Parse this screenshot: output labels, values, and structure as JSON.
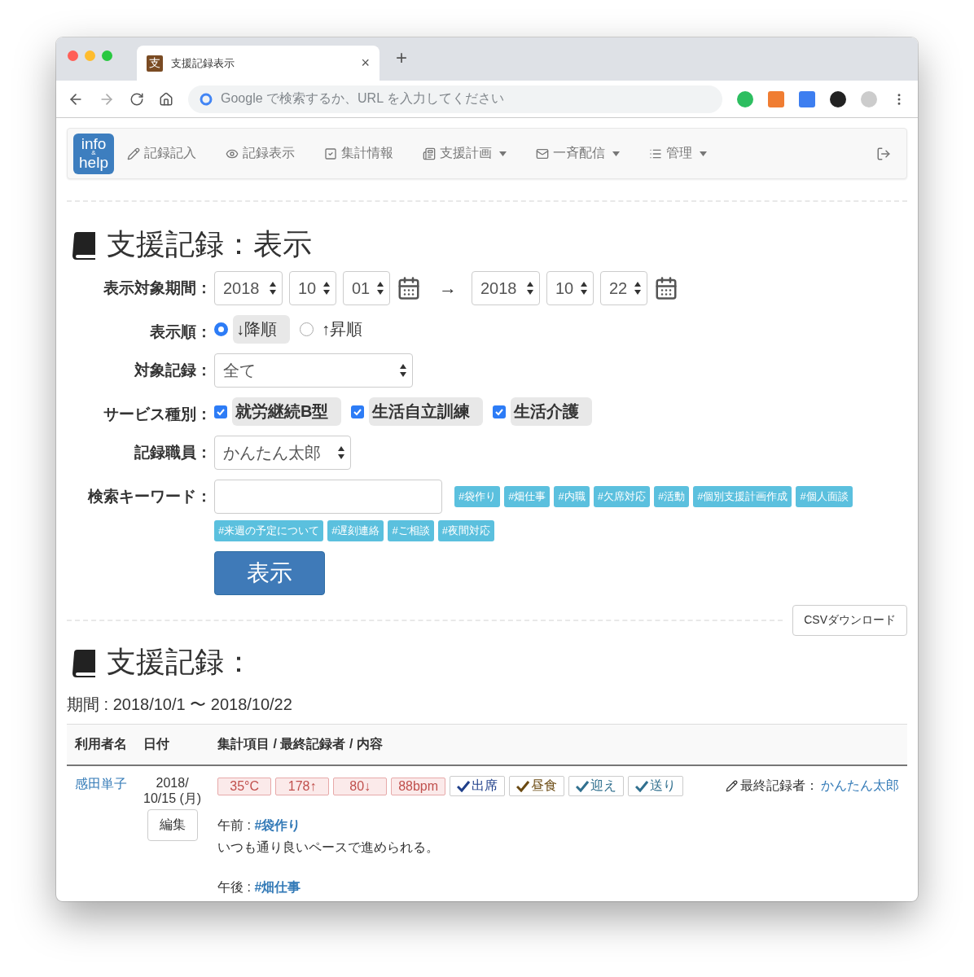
{
  "browser": {
    "tab_title": "支援記録表示",
    "tab_favicon": "支",
    "tab_close": "×",
    "new_tab": "+",
    "address_placeholder": "Google で検索するか、URL を入力してください"
  },
  "navbar": {
    "logo": [
      "info",
      "&",
      "help"
    ],
    "items": [
      {
        "label": "記録記入",
        "dropdown": false
      },
      {
        "label": "記録表示",
        "dropdown": false
      },
      {
        "label": "集計情報",
        "dropdown": false
      },
      {
        "label": "支援計画",
        "dropdown": true
      },
      {
        "label": "一斉配信",
        "dropdown": true
      },
      {
        "label": "管理",
        "dropdown": true
      }
    ]
  },
  "search_section": {
    "title": "支援記録：表示",
    "period": {
      "label": "表示対象期間：",
      "from": [
        "2018",
        "10",
        "01"
      ],
      "arrow": "→",
      "to": [
        "2018",
        "10",
        "22"
      ]
    },
    "order": {
      "label": "表示順：",
      "options": [
        {
          "label": "↓降順",
          "selected": true
        },
        {
          "label": "↑昇順",
          "selected": false
        }
      ]
    },
    "target": {
      "label": "対象記録：",
      "value": "全て"
    },
    "service": {
      "label": "サービス種別：",
      "options": [
        {
          "label": "就労継続B型",
          "checked": true
        },
        {
          "label": "生活自立訓練",
          "checked": true
        },
        {
          "label": "生活介護",
          "checked": true
        }
      ]
    },
    "staff": {
      "label": "記録職員：",
      "value": "かんたん太郎"
    },
    "keyword": {
      "label": "検索キーワード：",
      "tags": [
        "#袋作り",
        "#畑仕事",
        "#内職",
        "#欠席対応",
        "#活動",
        "#個別支援計画作成",
        "#個人面談",
        "#来週の予定について",
        "#遅刻連絡",
        "#ご相談",
        "#夜間対応"
      ]
    },
    "submit": "表示"
  },
  "csv_button": "CSVダウンロード",
  "result_section": {
    "title": "支援記録：",
    "period": "期間 : 2018/10/1 〜 2018/10/22",
    "table": {
      "columns": [
        "利用者名",
        "日付",
        "集計項目 / 最終記録者 / 内容"
      ],
      "rows": [
        {
          "name": "感田単子",
          "date": [
            "2018/",
            "10/15 (月)"
          ],
          "edit": "編集",
          "badges": [
            {
              "label": "35°C",
              "kind": "vital"
            },
            {
              "label": "178↑",
              "kind": "vital"
            },
            {
              "label": "80↓",
              "kind": "vital"
            },
            {
              "label": "88bpm",
              "kind": "vital"
            },
            {
              "label": "出席",
              "kind": "check",
              "color": "#1f3f8a"
            },
            {
              "label": "昼食",
              "kind": "check",
              "color": "#6b4a12"
            },
            {
              "label": "迎え",
              "kind": "check",
              "color": "#31708f"
            },
            {
              "label": "送り",
              "kind": "check",
              "color": "#31708f"
            }
          ],
          "recorder_label": "最終記録者：",
          "recorder": "かんたん太郎",
          "entries": [
            {
              "period": "午前 : ",
              "tag": "#袋作り",
              "text": "いつも通り良いペースで進められる。"
            },
            {
              "period": "午後 : ",
              "tag": "#畑仕事"
            }
          ]
        }
      ]
    }
  }
}
